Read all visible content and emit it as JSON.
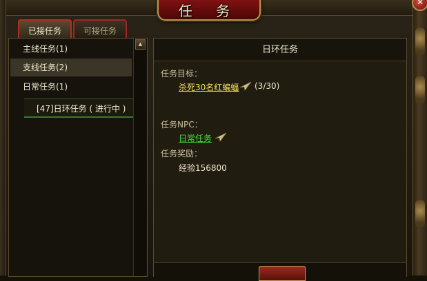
{
  "window": {
    "title": "任 务",
    "close_symbol": "✕"
  },
  "tabs": [
    {
      "label": "已接任务",
      "active": true
    },
    {
      "label": "可接任务",
      "active": false
    }
  ],
  "quest_list": {
    "items": [
      {
        "label": "主线任务(1)"
      },
      {
        "label": "支线任务(2)"
      },
      {
        "label": "日常任务(1)"
      }
    ],
    "sub_item": {
      "label": "[47]日环任务 ( 进行中 )"
    }
  },
  "detail": {
    "header": "日环任务",
    "target_label": "任务目标：",
    "target_link": "杀死30名红蝙蝠",
    "target_progress": "(3/30)",
    "npc_label": "任务NPC：",
    "npc_link": "日常任务",
    "reward_label": "任务奖励：",
    "reward_value": "经验156800"
  },
  "colors": {
    "target_link": "#f3e05a",
    "npc_link": "#3fe03a",
    "tab_border": "#b52a2a",
    "title_plaque": "#8a1414"
  }
}
